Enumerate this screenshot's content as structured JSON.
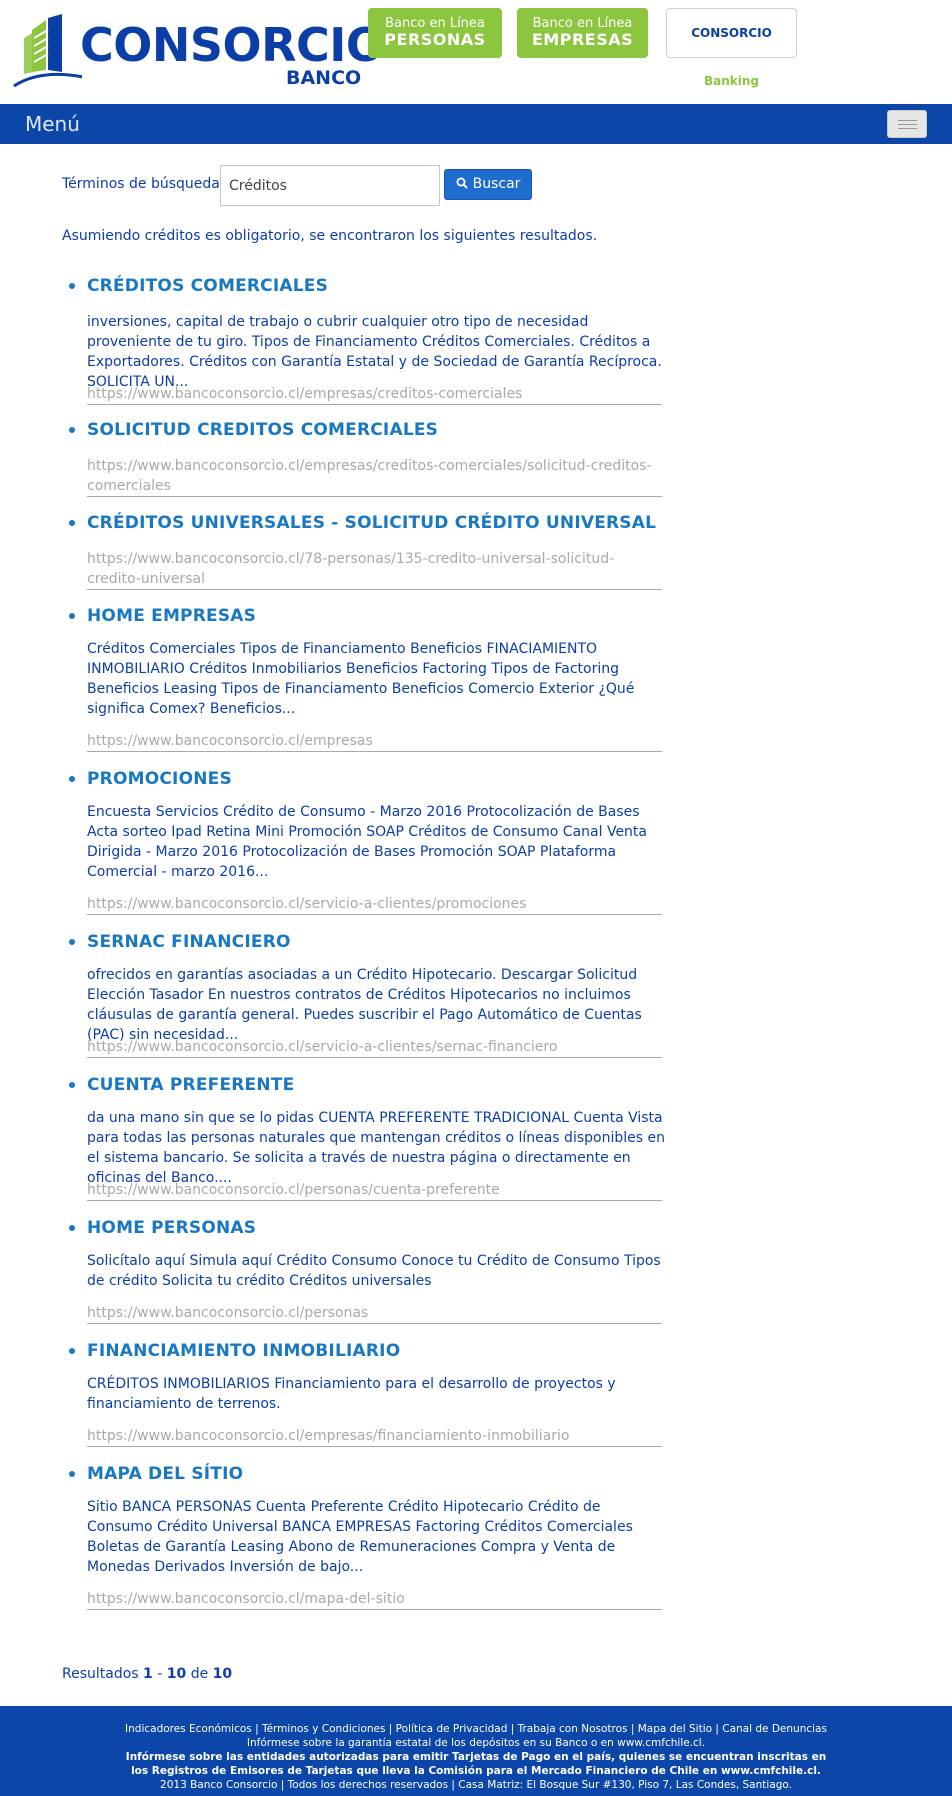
{
  "header": {
    "logo_word": "CONSORCIO",
    "logo_sub": "BANCO",
    "personas_line1": "Banco en Línea",
    "personas_line2": "PERSONAS",
    "empresas_line1": "Banco en Línea",
    "empresas_line2": "EMPRESAS",
    "banking_part1": "CONSORCIO",
    "banking_part2": "Banking"
  },
  "nav": {
    "menu_label": "Menú"
  },
  "search": {
    "label": "Términos de búsqueda:",
    "value": "Créditos",
    "button_label": "Buscar"
  },
  "notice": "Asumiendo créditos es obligatorio, se encontraron los siguientes resultados.",
  "results": [
    {
      "title": "CRÉDITOS COMERCIALES",
      "snippet": "inversiones, capital de trabajo o cubrir cualquier otro tipo de necesidad proveniente de tu giro. Tipos de Financiamento Créditos Comerciales. Créditos a Exportadores. Créditos con Garantía Estatal y de Sociedad de Garantía Recíproca. SOLICITA UN...",
      "url": "https://www.bancoconsorcio.cl/empresas/creditos-comerciales"
    },
    {
      "title": "SOLICITUD CREDITOS COMERCIALES",
      "snippet": "",
      "url": "https://www.bancoconsorcio.cl/empresas/creditos-comerciales/solicitud-creditos-comerciales"
    },
    {
      "title": "CRÉDITOS UNIVERSALES - SOLICITUD CRÉDITO UNIVERSAL",
      "snippet": "",
      "url": "https://www.bancoconsorcio.cl/78-personas/135-credito-universal-solicitud-credito-universal"
    },
    {
      "title": "HOME EMPRESAS",
      "snippet": "Créditos Comerciales Tipos de Financiamento Beneficios FINACIAMIENTO INMOBILIARIO Créditos Inmobiliarios Beneficios Factoring Tipos de Factoring Beneficios Leasing Tipos de Financiamento Beneficios Comercio Exterior ¿Qué significa Comex? Beneficios...",
      "url": "https://www.bancoconsorcio.cl/empresas"
    },
    {
      "title": "PROMOCIONES",
      "snippet": "Encuesta Servicios Crédito de Consumo - Marzo 2016 Protocolización de Bases Acta sorteo Ipad Retina Mini Promoción SOAP Créditos de Consumo Canal Venta Dirigida - Marzo 2016 Protocolización de Bases Promoción SOAP Plataforma Comercial - marzo 2016...",
      "url": "https://www.bancoconsorcio.cl/servicio-a-clientes/promociones"
    },
    {
      "title": "SERNAC FINANCIERO",
      "snippet": "ofrecidos en garantías asociadas a un Crédito Hipotecario. Descargar Solicitud Elección Tasador En nuestros contratos de Créditos Hipotecarios no incluimos cláusulas de garantía general. Puedes suscribir el Pago Automático de Cuentas (PAC) sin necesidad...",
      "url": "https://www.bancoconsorcio.cl/servicio-a-clientes/sernac-financiero"
    },
    {
      "title": "CUENTA PREFERENTE",
      "snippet": "da una mano sin que se lo pidas CUENTA PREFERENTE TRADICIONAL Cuenta Vista para todas las personas naturales que mantengan créditos o líneas disponibles en el sistema bancario. Se solicita a través de nuestra página o directamente en oficinas del Banco....",
      "url": "https://www.bancoconsorcio.cl/personas/cuenta-preferente"
    },
    {
      "title": "HOME PERSONAS",
      "snippet": "Solicítalo aquí Simula aquí Crédito Consumo Conoce tu Crédito de Consumo Tipos de crédito Solicita tu crédito Créditos universales",
      "url": "https://www.bancoconsorcio.cl/personas"
    },
    {
      "title": "FINANCIAMIENTO INMOBILIARIO",
      "snippet": "CRÉDITOS INMOBILIARIOS Financiamiento para el desarrollo de proyectos y financiamiento de terrenos.",
      "url": "https://www.bancoconsorcio.cl/empresas/financiamiento-inmobiliario"
    },
    {
      "title": "MAPA DEL SÍTIO",
      "snippet": "Sitio BANCA PERSONAS Cuenta Preferente Crédito Hipotecario Crédito de Consumo Crédito Universal BANCA EMPRESAS Factoring Créditos Comerciales Boletas de Garantía Leasing Abono de Remuneraciones Compra y Venta de Monedas Derivados Inversión de bajo...",
      "url": "https://www.bancoconsorcio.cl/mapa-del-sitio"
    }
  ],
  "pagination": {
    "prefix": "Resultados",
    "start": "1",
    "sep": "-",
    "end": "10",
    "of": "de",
    "total": "10"
  },
  "footer": {
    "links": "Indicadores Económicos | Términos y Condiciones | Política de Privacidad | Trabaja con Nosotros | Mapa del Sitio | Canal de Denuncias",
    "line2": "Infórmese sobre la garantía estatal de los depósitos en su Banco o en www.cmfchile.cl.",
    "line3": "Infórmese sobre las entidades autorizadas para emitir Tarjetas de Pago en el país, quienes se encuentran inscritas en",
    "line4": "los Registros de Emisores de Tarjetas que lleva la Comisión para el Mercado Financiero de Chile en www.cmfchile.cl.",
    "line5": "2013 Banco Consorcio | Todos los derechos reservados | Casa Matriz: El Bosque Sur #130, Piso 7, Las Condes, Santiago."
  },
  "colors": {
    "brand_blue": "#0c3ea8",
    "nav_blue": "#0c46a8",
    "title_blue": "#1a78c2",
    "green": "#8cc63f",
    "url_gray": "#a9a9a9"
  },
  "icons": {
    "search_button": "search-icon",
    "nav_toggle": "hamburger-icon"
  }
}
